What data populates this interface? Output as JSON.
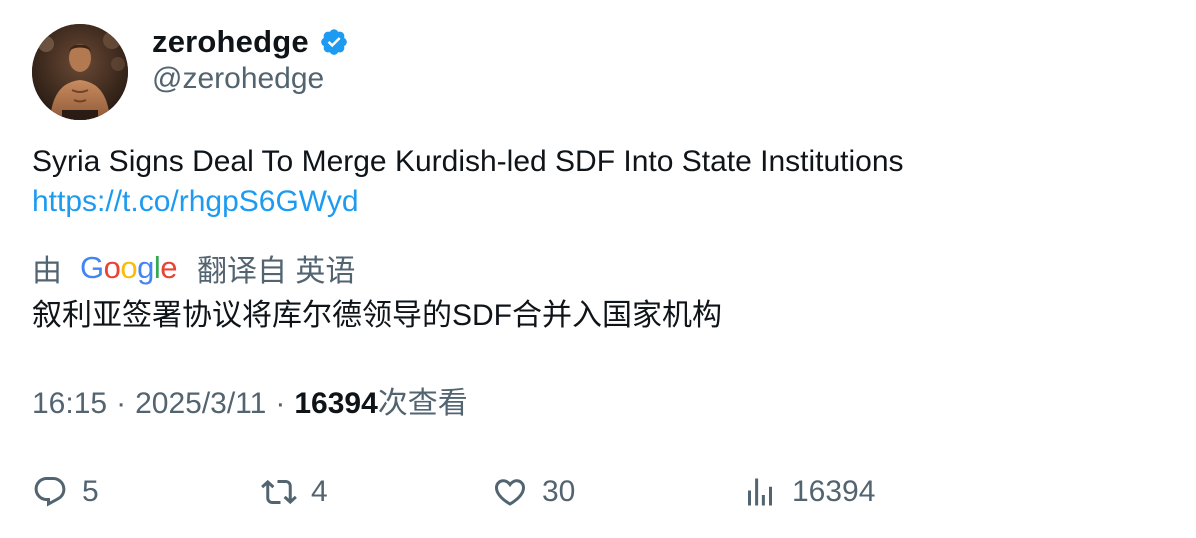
{
  "author": {
    "display_name": "zerohedge",
    "handle": "@zerohedge",
    "verified": true,
    "avatar_icon": "avatar-photo"
  },
  "tweet": {
    "text": "Syria Signs Deal To Merge Kurdish-led SDF Into State Institutions",
    "link": "https://t.co/rhgpS6GWyd"
  },
  "translation": {
    "by_label": "由",
    "provider": "Google",
    "translated_from_label": "翻译自 英语",
    "translated_text": "叙利亚签署协议将库尔德领导的SDF合并入国家机构"
  },
  "meta": {
    "time": "16:15",
    "separator": "·",
    "date": "2025/3/11",
    "views_count": "16394",
    "views_label": "次查看"
  },
  "actions": {
    "reply": {
      "icon": "reply-icon",
      "count": "5"
    },
    "retweet": {
      "icon": "retweet-icon",
      "count": "4"
    },
    "like": {
      "icon": "heart-icon",
      "count": "30"
    },
    "views": {
      "icon": "analytics-icon",
      "count": "16394"
    }
  },
  "colors": {
    "text": "#0f1419",
    "secondary": "#536471",
    "link": "#1d9bf0",
    "verified": "#1d9bf0"
  }
}
